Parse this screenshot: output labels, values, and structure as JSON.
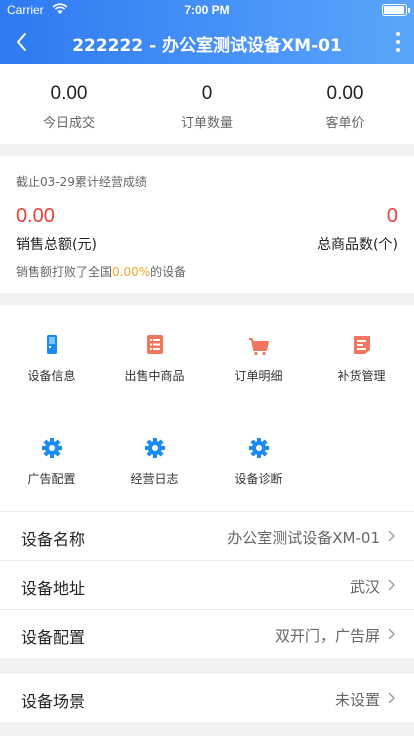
{
  "status_bar": {
    "carrier": "Carrier",
    "time": "7:00 PM"
  },
  "nav": {
    "title": "222222 - 办公室测试设备XM-01"
  },
  "stats": [
    {
      "value": "0.00",
      "label": "今日成交"
    },
    {
      "value": "0",
      "label": "订单数量"
    },
    {
      "value": "0.00",
      "label": "客单价"
    }
  ],
  "performance": {
    "title": "截止03-29累计经营成绩",
    "sales_value": "0.00",
    "sales_label": "销售总额(元)",
    "goods_value": "0",
    "goods_label": "总商品数(个)",
    "beat_prefix": "销售额打败了全国",
    "beat_percent": "0.00%",
    "beat_suffix": "的设备"
  },
  "menu": [
    {
      "label": "设备信息",
      "icon": "device-info-icon"
    },
    {
      "label": "出售中商品",
      "icon": "goods-list-icon"
    },
    {
      "label": "订单明细",
      "icon": "cart-icon"
    },
    {
      "label": "补货管理",
      "icon": "restock-icon"
    },
    {
      "label": "广告配置",
      "icon": "gear-icon"
    },
    {
      "label": "经营日志",
      "icon": "gear-icon"
    },
    {
      "label": "设备诊断",
      "icon": "gear-icon"
    }
  ],
  "details": [
    {
      "key": "设备名称",
      "value": "办公室测试设备XM-01"
    },
    {
      "key": "设备地址",
      "value": "武汉"
    },
    {
      "key": "设备配置",
      "value": "双开门，广告屏"
    },
    {
      "key": "设备场景",
      "value": "未设置"
    }
  ],
  "colors": {
    "header_start": "#2f79f2",
    "header_end": "#5aa6fb",
    "accent_red": "#e8413c",
    "accent_orange": "#f5a623",
    "icon_blue": "#1a8cf0",
    "icon_salmon": "#f2765f"
  }
}
